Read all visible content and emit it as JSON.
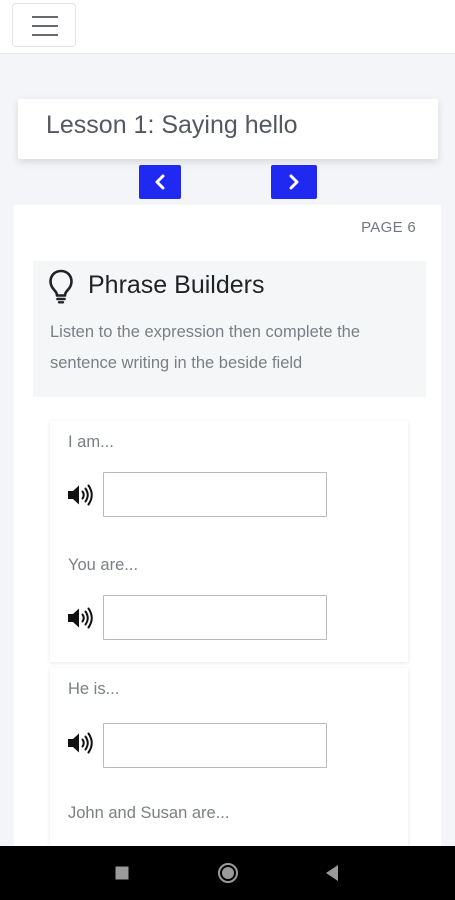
{
  "header": {
    "menu_icon": "hamburger-menu-icon"
  },
  "lesson": {
    "title": "Lesson 1: Saying hello"
  },
  "navigation": {
    "prev_icon": "chevron-left-icon",
    "next_icon": "chevron-right-icon",
    "button_color": "#2029f2"
  },
  "page": {
    "label": "PAGE 6"
  },
  "activity": {
    "icon": "lightbulb-icon",
    "title": "Phrase Builders",
    "instructions": "Listen to the expression then complete the sentence writing in the beside field"
  },
  "exercises": [
    {
      "prompt": "I am...",
      "answer": ""
    },
    {
      "prompt": "You are...",
      "answer": ""
    },
    {
      "prompt": "He is...",
      "answer": ""
    },
    {
      "prompt": "John and Susan are...",
      "answer": ""
    }
  ],
  "system_nav": {
    "recents_icon": "square-recents-icon",
    "home_icon": "circle-home-icon",
    "back_icon": "triangle-back-icon"
  }
}
